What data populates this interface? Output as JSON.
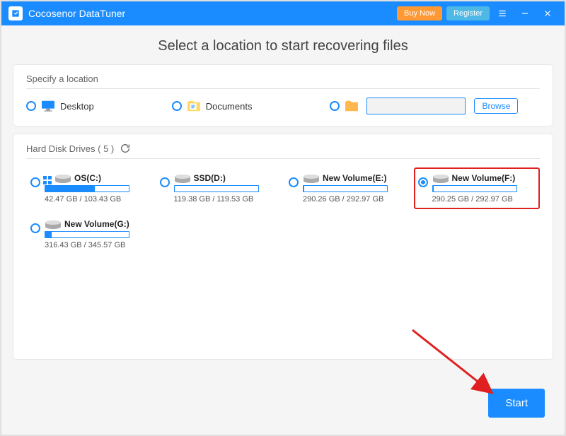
{
  "titlebar": {
    "app_title": "Cocosenor DataTuner",
    "buy_label": "Buy Now",
    "register_label": "Register"
  },
  "page_heading": "Select a location to start recovering files",
  "specify_section": {
    "title": "Specify a location",
    "desktop_label": "Desktop",
    "documents_label": "Documents",
    "browse_label": "Browse"
  },
  "drives_section": {
    "title_prefix": "Hard Disk Drives ( ",
    "count": "5",
    "title_suffix": " )",
    "drives": [
      {
        "name": "OS(C:)",
        "free": "42.47 GB",
        "total": "103.43 GB",
        "used_pct": 59,
        "has_win_icon": true,
        "selected": false
      },
      {
        "name": "SSD(D:)",
        "free": "119.38 GB",
        "total": "119.53 GB",
        "used_pct": 0,
        "has_win_icon": false,
        "selected": false
      },
      {
        "name": "New Volume(E:)",
        "free": "290.26 GB",
        "total": "292.97 GB",
        "used_pct": 1,
        "has_win_icon": false,
        "selected": false
      },
      {
        "name": "New Volume(F:)",
        "free": "290.25 GB",
        "total": "292.97 GB",
        "used_pct": 1,
        "has_win_icon": false,
        "selected": true,
        "highlighted": true
      },
      {
        "name": "New Volume(G:)",
        "free": "316.43 GB",
        "total": "345.57 GB",
        "used_pct": 8,
        "has_win_icon": false,
        "selected": false
      }
    ]
  },
  "start_label": "Start"
}
